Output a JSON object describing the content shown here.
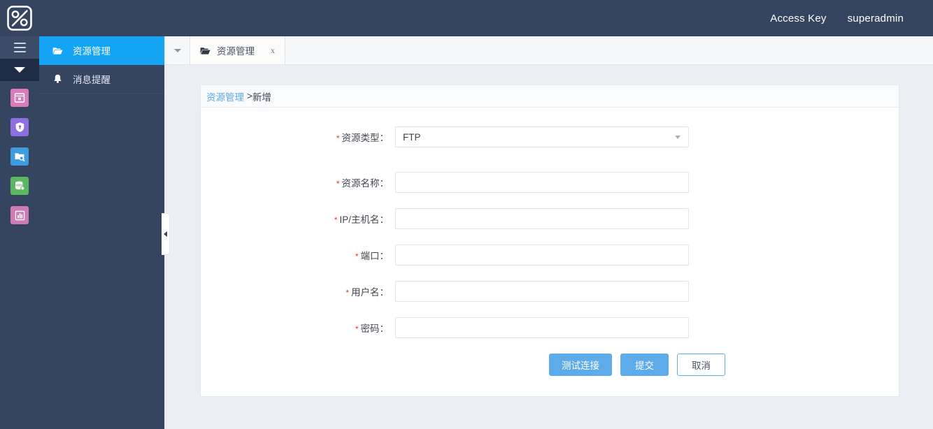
{
  "topbar": {
    "logo_icon": "percent-logo-icon",
    "links": [
      {
        "label": "Access Key",
        "name": "access-key-link"
      },
      {
        "label": "superadmin",
        "name": "user-menu-link"
      }
    ]
  },
  "iconrail": {
    "menu_toggle_icon": "hamburger-icon",
    "collapse_icon": "triangle-down-icon",
    "items": [
      {
        "name": "sidebar-icon-terminal",
        "icon": "terminal-window-icon",
        "color": "#d87bb8"
      },
      {
        "name": "sidebar-icon-security",
        "icon": "shield-icon",
        "color": "#8d6fe0"
      },
      {
        "name": "sidebar-icon-file-audit",
        "icon": "folder-search-icon",
        "color": "#3e9be0"
      },
      {
        "name": "sidebar-icon-database",
        "icon": "database-wrench-icon",
        "color": "#5cb860"
      },
      {
        "name": "sidebar-icon-reports",
        "icon": "bar-chart-icon",
        "color": "#cf7bb4"
      }
    ]
  },
  "nav": {
    "items": [
      {
        "label": "资源管理",
        "icon": "folder-open-icon",
        "active": true,
        "name": "nav-item-resource-management"
      },
      {
        "label": "消息提醒",
        "icon": "bell-icon",
        "active": false,
        "name": "nav-item-message-alerts"
      }
    ]
  },
  "collapse_handle": {
    "icon": "chevron-left-icon",
    "name": "sidebar-collapse-handle"
  },
  "tabs": {
    "dropdown_icon": "caret-down-icon",
    "items": [
      {
        "label": "资源管理",
        "icon": "folder-open-icon",
        "close": "x",
        "active": true,
        "name": "tab-resource-management"
      }
    ]
  },
  "breadcrumb": {
    "link": "资源管理",
    "separator": ">",
    "current": "新增"
  },
  "form": {
    "fields": [
      {
        "name": "resource-type",
        "label": "资源类型：",
        "required": true,
        "type": "select",
        "value": "FTP",
        "placeholder": ""
      },
      {
        "name": "resource-name",
        "label": "资源名称：",
        "required": true,
        "type": "text",
        "value": "",
        "placeholder": ""
      },
      {
        "name": "ip-hostname",
        "label": "IP/主机名：",
        "required": true,
        "type": "text",
        "value": "",
        "placeholder": ""
      },
      {
        "name": "port",
        "label": "端口：",
        "required": true,
        "type": "text",
        "value": "",
        "placeholder": ""
      },
      {
        "name": "username",
        "label": "用户名：",
        "required": true,
        "type": "text",
        "value": "",
        "placeholder": ""
      },
      {
        "name": "password",
        "label": "密码：",
        "required": true,
        "type": "text",
        "value": "",
        "placeholder": ""
      }
    ],
    "buttons": [
      {
        "label": "测试连接",
        "name": "test-connection-button",
        "style": "primary"
      },
      {
        "label": "提交",
        "name": "submit-button",
        "style": "primary"
      },
      {
        "label": "取消",
        "name": "cancel-button",
        "style": "ghost"
      }
    ]
  },
  "colors": {
    "header_bg": "#354560",
    "nav_active": "#14a4f3",
    "accent_blue": "#5dace9",
    "required_red": "#e8392e",
    "page_bg": "#ebeef3",
    "link_blue": "#59a7e8"
  }
}
